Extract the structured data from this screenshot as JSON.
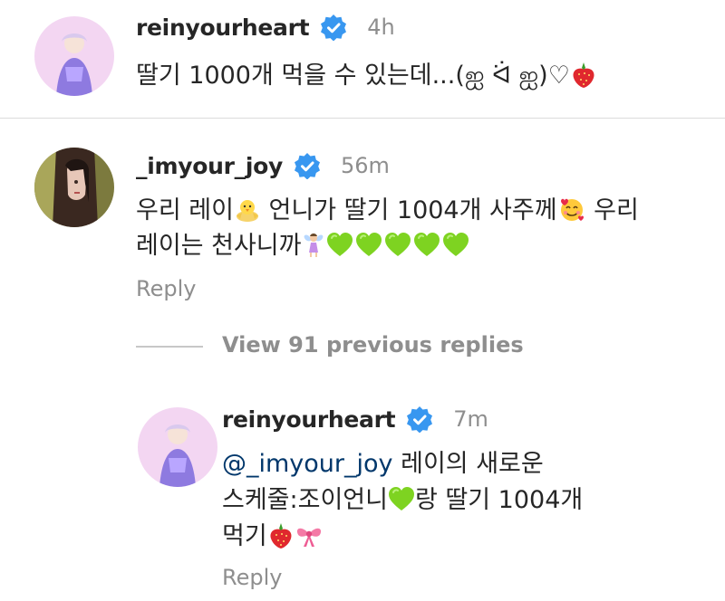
{
  "comment1": {
    "username": "reinyourheart",
    "time": "4h",
    "text": "딸기 1000개 먹을 수 있는데...(ஐ ᐛ ஐ)♡"
  },
  "comment2": {
    "username": "_imyour_joy",
    "time": "56m",
    "line1_part1": "우리 레이",
    "line1_part2": " 언니가 딸기 1004개 사주께",
    "line1_part3": " 우리",
    "line2": "레이는 천사니까",
    "reply_label": "Reply"
  },
  "view_replies": "View 91 previous replies",
  "reply": {
    "username": "reinyourheart",
    "time": "7m",
    "mention": "@_imyour_joy",
    "line1_rest": " 레이의 새로운",
    "line2_part1": "스케줄:조이언니",
    "line2_part2": "랑 딸기 1004개",
    "line3": "먹기",
    "reply_label": "Reply"
  },
  "icons": {
    "verified": "verified-badge-icon",
    "strawberry": "strawberry-emoji",
    "chick": "chick-emoji",
    "smiling_hearts": "smiling-face-with-hearts-emoji",
    "fairy": "fairy-emoji",
    "green_heart": "green-heart-emoji",
    "ribbon": "ribbon-emoji"
  },
  "colors": {
    "verified_blue": "#3897f0",
    "secondary_text": "#8e8e8e",
    "mention": "#00376b",
    "green_heart": "#7ed321"
  }
}
